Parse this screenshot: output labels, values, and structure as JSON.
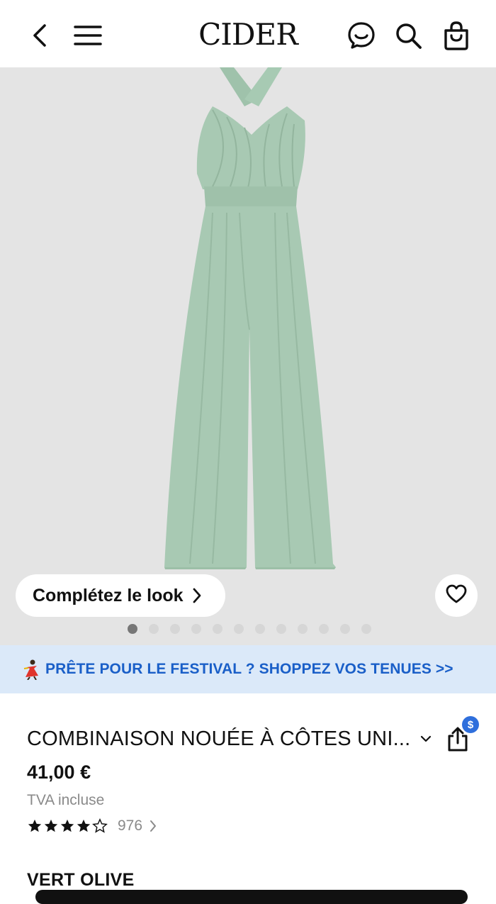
{
  "header": {
    "logo": "CIDER",
    "icons": [
      "back-icon",
      "menu-icon",
      "chat-icon",
      "search-icon",
      "bag-icon"
    ]
  },
  "hero": {
    "image_subject": "sage green halter jumpsuit",
    "product_color": "#a8c9b3",
    "look_button_label": "Complétez le look",
    "carousel_total": 12,
    "carousel_active": 1
  },
  "promo": {
    "text": "PRÊTE POUR LE FESTIVAL ? SHOPPEZ VOS TENUES >>",
    "color": "#1a5fc8",
    "background": "#dbe9f9"
  },
  "product": {
    "title": "COMBINAISON NOUÉE À CÔTES UNI...",
    "price": "41,00 €",
    "tax_note": "TVA incluse",
    "rating_stars": 4,
    "review_count": "976",
    "share_badge": "$",
    "color_label": "VERT OLIVE"
  }
}
